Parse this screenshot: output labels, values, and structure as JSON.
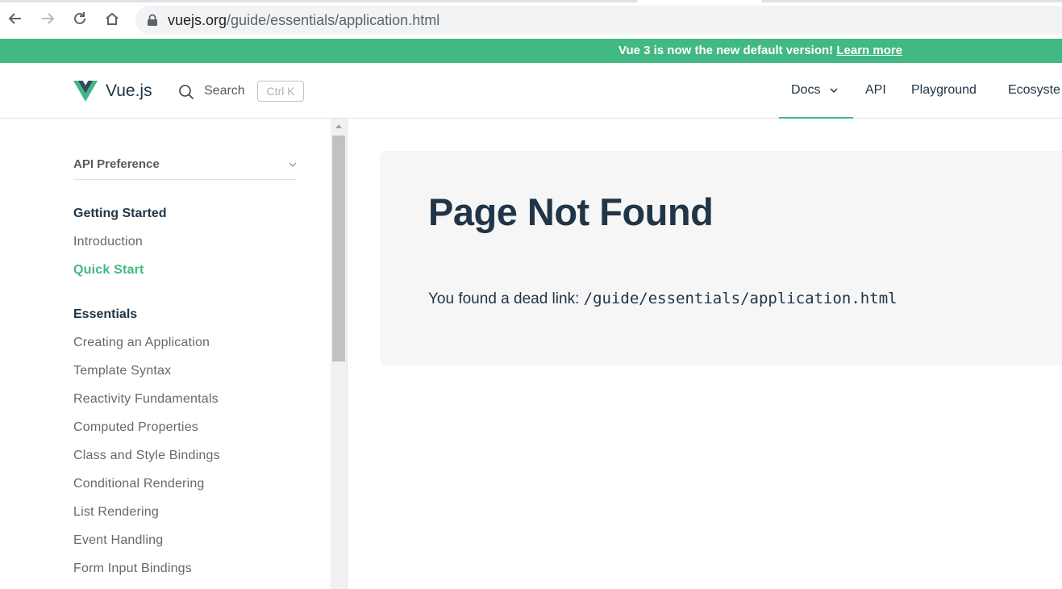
{
  "browser": {
    "url_host": "vuejs.org",
    "url_path": "/guide/essentials/application.html"
  },
  "banner": {
    "text": "Vue 3 is now the new default version!",
    "link": "Learn more",
    "color": "#42b883"
  },
  "navbar": {
    "brand": "Vue.js",
    "search_label": "Search",
    "search_shortcut": "Ctrl K",
    "items": [
      {
        "label": "Docs",
        "has_dropdown": true,
        "active": true
      },
      {
        "label": "API"
      },
      {
        "label": "Playground"
      },
      {
        "label": "Ecosyste"
      }
    ]
  },
  "sidebar": {
    "api_preference": "API Preference",
    "sections": [
      {
        "title": "Getting Started",
        "items": [
          {
            "label": "Introduction",
            "active": false
          },
          {
            "label": "Quick Start",
            "active": true
          }
        ]
      },
      {
        "title": "Essentials",
        "items": [
          {
            "label": "Creating an Application"
          },
          {
            "label": "Template Syntax"
          },
          {
            "label": "Reactivity Fundamentals"
          },
          {
            "label": "Computed Properties"
          },
          {
            "label": "Class and Style Bindings"
          },
          {
            "label": "Conditional Rendering"
          },
          {
            "label": "List Rendering"
          },
          {
            "label": "Event Handling"
          },
          {
            "label": "Form Input Bindings"
          }
        ]
      }
    ]
  },
  "main": {
    "title": "Page Not Found",
    "deadlink_text": "You found a dead link:",
    "deadlink_path": "/guide/essentials/application.html"
  },
  "colors": {
    "accent": "#42b883",
    "text": "#213547",
    "card_bg": "#f6f6f7"
  }
}
